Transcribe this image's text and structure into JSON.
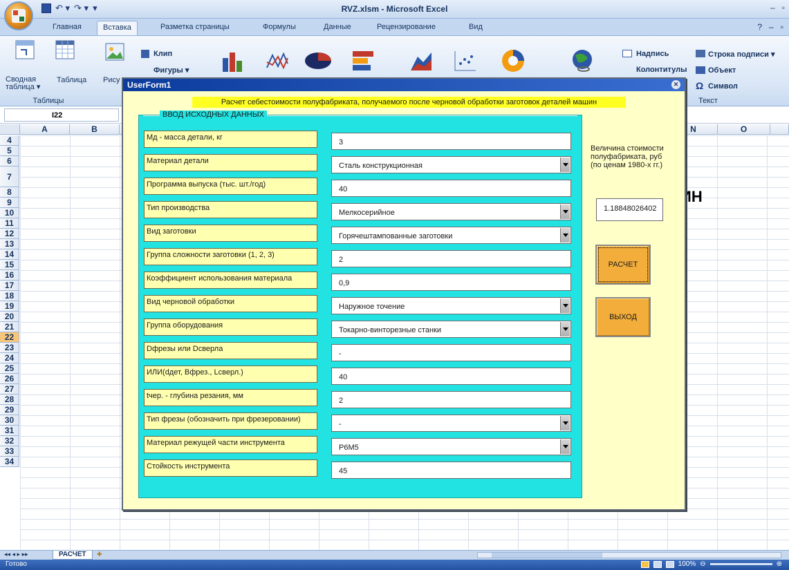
{
  "window": {
    "title": "RVZ.xlsm - Microsoft Excel"
  },
  "ribbon_tabs": [
    "Главная",
    "Вставка",
    "Разметка страницы",
    "Формулы",
    "Данные",
    "Рецензирование",
    "Вид"
  ],
  "ribbon": {
    "pivot_label": "Сводная таблица ▾",
    "pivot_line1": "Сводная",
    "pivot_line2": "таблица ▾",
    "table_label": "Таблица",
    "tables_group": "Таблицы",
    "picture_label": "Рису",
    "clip_label": "Клип",
    "shapes_label": "Фигуры ▾",
    "textbox_label": "Надпись",
    "headers_label": "Колонтитулы",
    "signature_label": "Строка подписи ▾",
    "object_label": "Объект",
    "symbol_label": "Символ",
    "text_group": "Текст"
  },
  "namebox": "I22",
  "columns": [
    "A",
    "B",
    "N",
    "O"
  ],
  "rows": [
    "4",
    "5",
    "6",
    "7",
    "8",
    "9",
    "10",
    "11",
    "12",
    "13",
    "14",
    "15",
    "16",
    "17",
    "18",
    "19",
    "20",
    "21",
    "22",
    "23",
    "24",
    "25",
    "26",
    "27",
    "28",
    "29",
    "30",
    "31",
    "32",
    "33",
    "34"
  ],
  "selected_row": "22",
  "sheet_fragment": "ИН",
  "sheet_tab": "РАСЧЕТ",
  "status": "Готово",
  "zoom": "100%",
  "form": {
    "title": "UserForm1",
    "banner": "Расчет себестоимости полуфабриката, получаемого после черновой обработки заготовок деталей машин",
    "frame_caption": "ВВОД ИСХОДНЫХ ДАННЫХ",
    "fields": [
      {
        "label": "Мд -  масса детали, кг",
        "value": "3",
        "dropdown": false
      },
      {
        "label": "Материал детали",
        "value": "Сталь конструкционная",
        "dropdown": true
      },
      {
        "label": "Программа выпуска (тыс. шт./год)",
        "value": "40",
        "dropdown": false
      },
      {
        "label": "Тип производства",
        "value": "Мелкосерийное",
        "dropdown": true
      },
      {
        "label": "Вид заготовки",
        "value": "Горячештампованные заготовки",
        "dropdown": true
      },
      {
        "label": "Группа сложности заготовки (1, 2, 3)",
        "value": "2",
        "dropdown": false
      },
      {
        "label": "Коэффициент использования материала",
        "value": "0,9",
        "dropdown": false
      },
      {
        "label": "Вид черновой обработки",
        "value": "Наружное точение",
        "dropdown": true
      },
      {
        "label": "Группа оборудования",
        "value": "Токарно-винторезные станки",
        "dropdown": true
      },
      {
        "label": "Dфрезы или Dсверла",
        "value": "-",
        "dropdown": false
      },
      {
        "label": "ИЛИ(dдет, Bфрез., Lсверл.)",
        "value": "40",
        "dropdown": false
      },
      {
        "label": "tчер. - глубина резания, мм",
        "value": "2",
        "dropdown": false
      },
      {
        "label": "Тип фрезы (обозначить при фрезеровании)",
        "value": "-",
        "dropdown": true
      },
      {
        "label": "Материал режущей части инструмента",
        "value": "Р6М5",
        "dropdown": true
      },
      {
        "label": "Стойкость  инструмента",
        "value": "45",
        "dropdown": false
      }
    ],
    "cost_label": "Величина стоимости полуфабриката, руб (по ценам 1980-х гг.)",
    "cost_value": "1.18848026402",
    "calc_button": "РАСЧЕТ",
    "exit_button": "ВЫХОД"
  }
}
